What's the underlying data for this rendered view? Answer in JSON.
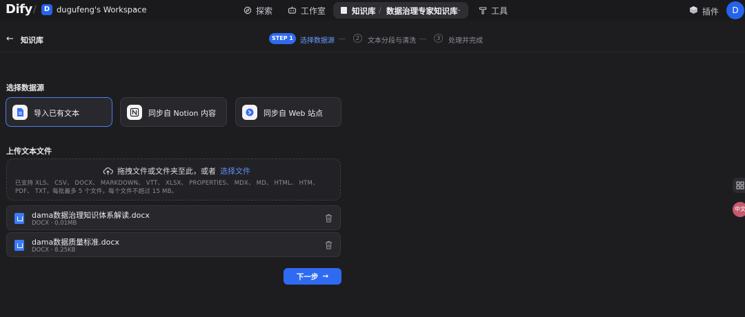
{
  "topnav": {
    "logo": "Dify",
    "workspace_initial": "D",
    "workspace_name": "dugufeng's Workspace",
    "explore_label": "探索",
    "studio_label": "工作室",
    "knowledge_label": "知识库",
    "dataset_name": "数据治理专家知识库",
    "tools_label": "工具",
    "plugins_label": "插件",
    "avatar_initial": "D"
  },
  "subheader": {
    "back_label": "知识库",
    "steps": [
      {
        "badge": "STEP 1",
        "label": "选择数据源"
      },
      {
        "num": "2",
        "label": "文本分段与清洗"
      },
      {
        "num": "3",
        "label": "处理并完成"
      }
    ]
  },
  "datasource": {
    "title": "选择数据源",
    "options": [
      {
        "label": "导入已有文本",
        "selected": true
      },
      {
        "label": "同步自 Notion 内容"
      },
      {
        "label": "同步自 Web 站点"
      }
    ]
  },
  "upload": {
    "title": "上传文本文件",
    "drop_text": "拖拽文件或文件夹至此，或者",
    "drop_link": "选择文件",
    "hint": "已支持 XLS、 CSV、 DOCX、 MARKDOWN、 VTT、 XLSX、 PROPERTIES、 MDX、 MD、 HTML、 HTM、 PDF、 TXT，每批最多 5 个文件，每个文件不超过 15 MB。",
    "files": [
      {
        "name": "dama数据治理知识体系解读.docx",
        "meta": "DOCX · 0.01MB"
      },
      {
        "name": "dama数据质量标准.docx",
        "meta": "DOCX · 8.25KB"
      }
    ]
  },
  "next_button": "下一步",
  "widgets": {
    "translate_label": "中文"
  },
  "colors": {
    "accent": "#2f6bf0",
    "link": "#5d8ff8",
    "background": "#1d1d20"
  }
}
